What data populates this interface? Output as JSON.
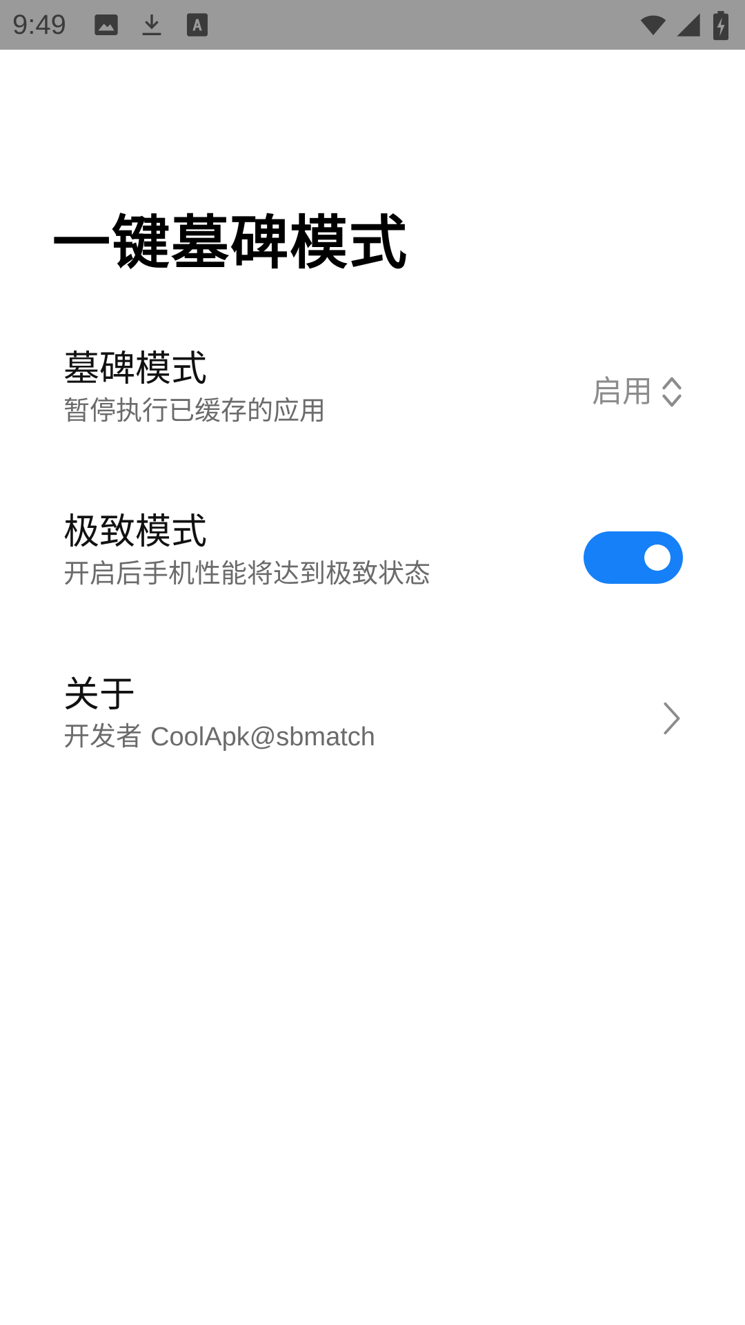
{
  "status_bar": {
    "time": "9:49",
    "icons": [
      "image-icon",
      "download-icon",
      "font-icon",
      "wifi-icon",
      "signal-icon",
      "battery-charging-icon"
    ]
  },
  "page": {
    "title": "一键墓碑模式"
  },
  "settings": {
    "tombstone": {
      "title": "墓碑模式",
      "subtitle": "暂停执行已缓存的应用",
      "value": "启用"
    },
    "extreme": {
      "title": "极致模式",
      "subtitle": "开启后手机性能将达到极致状态",
      "enabled": true
    },
    "about": {
      "title": "关于",
      "subtitle_prefix": "开发者",
      "subtitle_name": "CoolApk@sbmatch"
    }
  },
  "colors": {
    "status_bar_bg": "#9a9a9a",
    "accent": "#1580f8",
    "background": "#ffffff"
  }
}
